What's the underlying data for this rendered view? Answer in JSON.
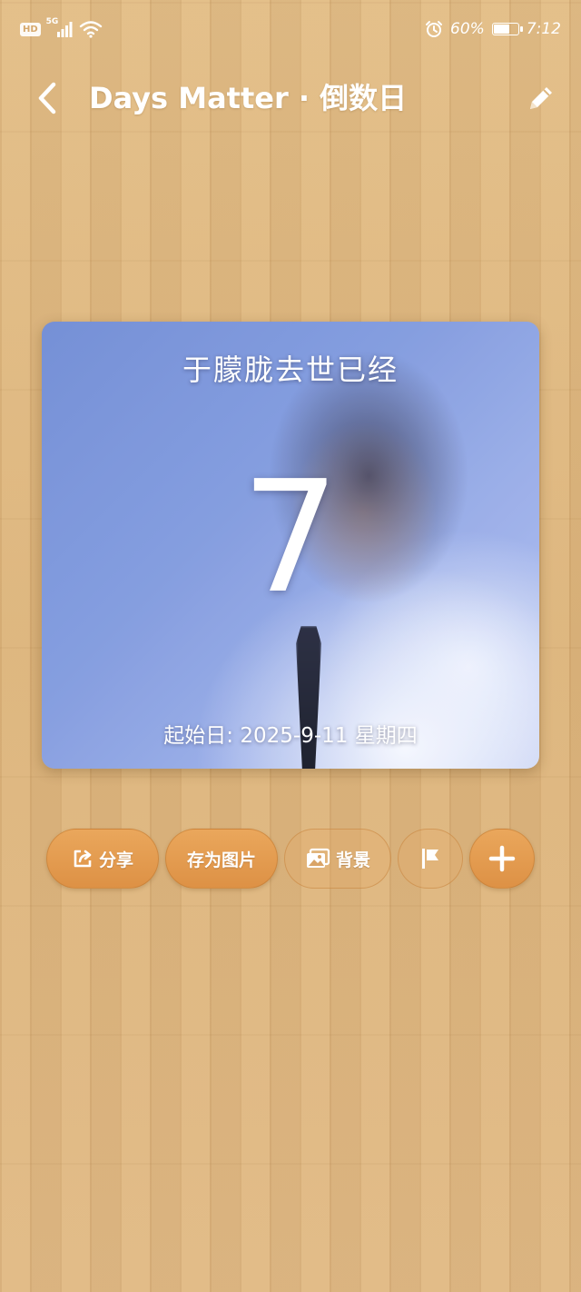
{
  "status_bar": {
    "hd_label": "HD",
    "network_label": "5G",
    "battery_percent": "60%",
    "battery_level": 0.6,
    "time": "7:12"
  },
  "header": {
    "title": "Days Matter · 倒数日",
    "back_icon": "chevron-left-icon",
    "edit_icon": "pencil-icon"
  },
  "card": {
    "title": "于朦胧去世已经",
    "count": "7",
    "start_date": "起始日: 2025-9-11 星期四"
  },
  "actions": {
    "share_label": "分享",
    "save_image_label": "存为图片",
    "background_label": "背景",
    "flag_icon": "flag-icon",
    "add_icon": "plus-icon"
  },
  "colors": {
    "accent": "#e29c51",
    "wood": "#ddb882",
    "text": "#ffffff"
  }
}
